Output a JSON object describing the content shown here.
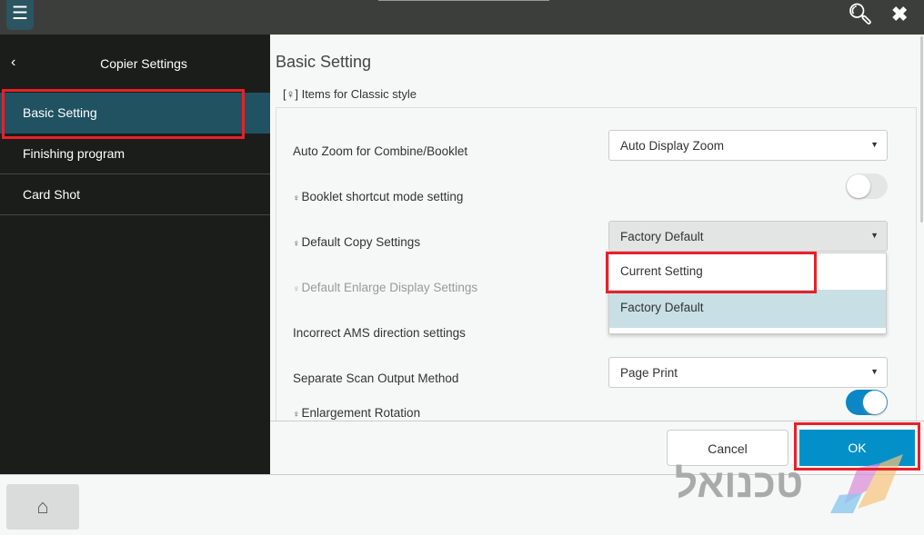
{
  "topbar": {
    "menu_icon": "hamburger-icon",
    "search_icon": "search-icon",
    "close_icon": "close-icon"
  },
  "sidebar": {
    "title": "Copier Settings",
    "back_icon": "chevron-left-icon",
    "items": [
      {
        "label": "Basic Setting",
        "active": true
      },
      {
        "label": "Finishing program"
      },
      {
        "label": "Card Shot"
      }
    ]
  },
  "main": {
    "title": "Basic Setting",
    "subtitle": "[♀] Items for Classic style",
    "rows": [
      {
        "label": "Auto Zoom for Combine/Booklet",
        "value": "Auto Display Zoom"
      },
      {
        "label": "Booklet shortcut mode setting",
        "toggle": false
      },
      {
        "label": "Default Copy Settings",
        "value": "Factory Default"
      },
      {
        "label": "Default Enlarge Display Settings",
        "disabled": true
      },
      {
        "label": "Incorrect AMS direction settings"
      },
      {
        "label": "Separate Scan Output Method",
        "value": "Page Print"
      },
      {
        "label": "Enlargement Rotation",
        "toggle": true
      }
    ],
    "dropdown": {
      "options": [
        "Current Setting",
        "Factory Default"
      ],
      "highlighted": "Factory Default"
    }
  },
  "footer": {
    "cancel": "Cancel",
    "ok": "OK"
  },
  "bottom": {
    "home_icon": "home-icon",
    "watermark": "טכנואל"
  },
  "colors": {
    "accent": "#0390c8",
    "highlight": "#e8202a",
    "sidebar_active": "#205261"
  }
}
